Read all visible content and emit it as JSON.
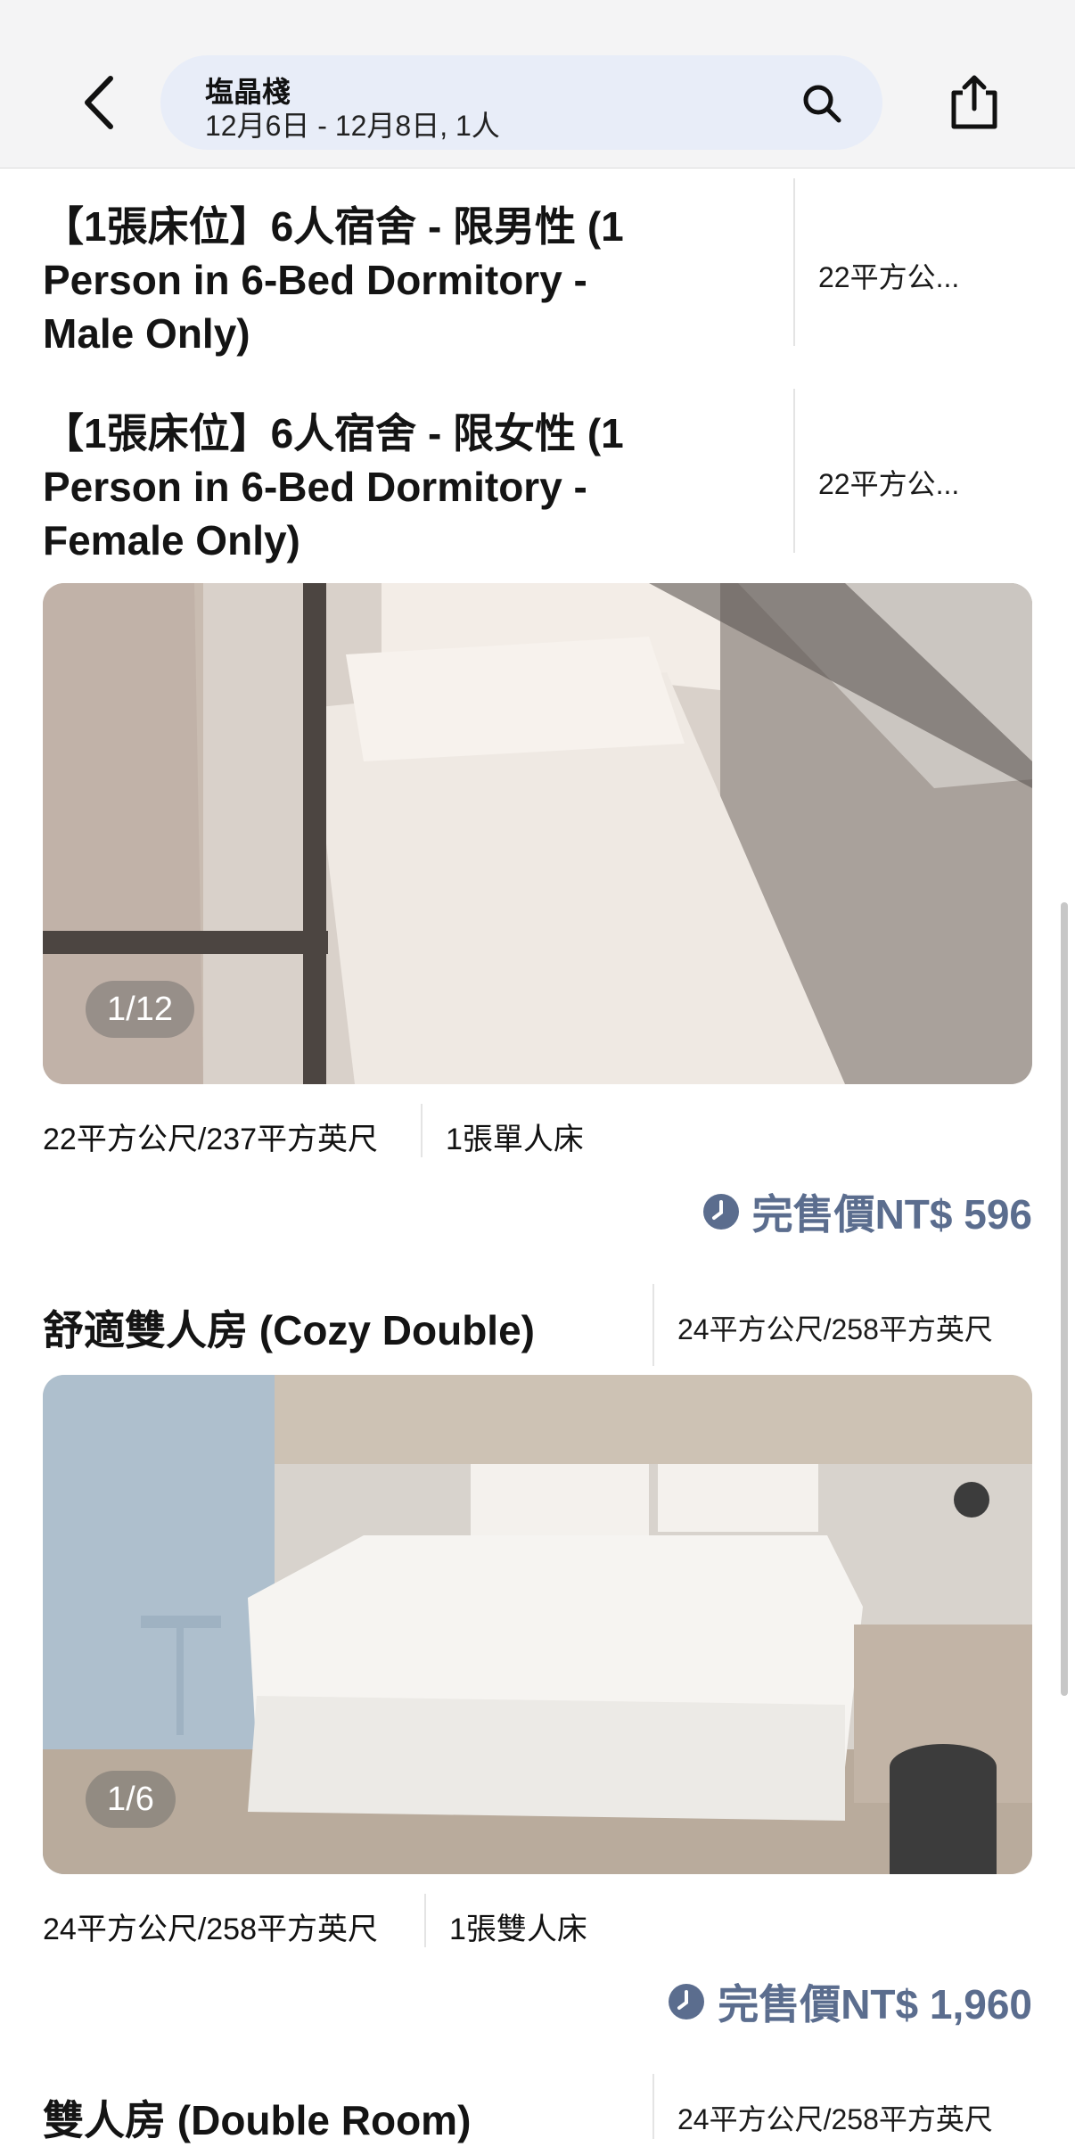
{
  "header": {
    "hotel_name": "塩晶棧",
    "search_details": "12月6日 - 12月8日, 1人"
  },
  "rooms": [
    {
      "title": "【1張床位】6人宿舍 - 限男性 (1 Person in 6-Bed Dormitory - Male Only)",
      "size_truncated": "22平方公..."
    },
    {
      "title": "【1張床位】6人宿舍 - 限女性 (1 Person in 6-Bed Dormitory - Female Only)",
      "size_truncated": "22平方公...",
      "photo_counter": "1/12",
      "area": "22平方公尺/237平方英尺",
      "bed": "1張單人床",
      "price_label": "完售價NT$ 596"
    },
    {
      "title": "舒適雙人房 (Cozy Double)",
      "size": "24平方公尺/258平方英尺",
      "photo_counter": "1/6",
      "area": "24平方公尺/258平方英尺",
      "bed": "1張雙人床",
      "price_label": "完售價NT$ 1,960"
    },
    {
      "title": "雙人房 (Double Room)",
      "size": "24平方公尺/258平方英尺"
    }
  ],
  "icons": {
    "back": "chevron-left-icon",
    "search": "search-icon",
    "share": "share-icon",
    "price_clock": "clock-icon"
  },
  "colors": {
    "accent": "#5b6d8e",
    "search_bg": "#e8edf8",
    "header_bg": "#f4f4f5"
  }
}
